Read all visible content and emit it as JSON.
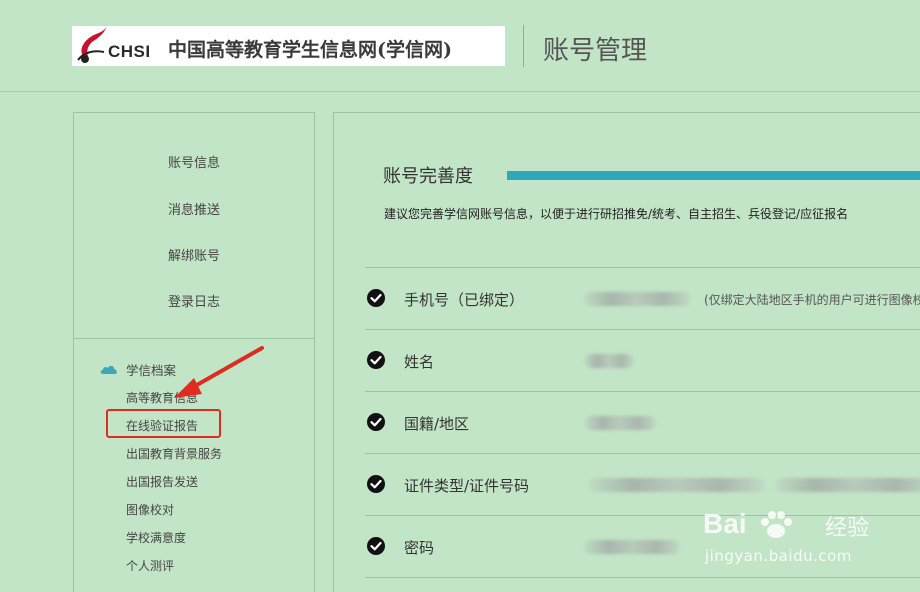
{
  "header": {
    "logo_abbr": "CHSI",
    "site_name": "中国高等教育学生信息网(学信网)",
    "page_title": "账号管理"
  },
  "sidebar": {
    "account_items": [
      {
        "label": "账号信息"
      },
      {
        "label": "消息推送"
      },
      {
        "label": "解绑账号"
      },
      {
        "label": "登录日志"
      }
    ],
    "archive": {
      "title": "学信档案",
      "items": [
        {
          "label": "高等教育信息"
        },
        {
          "label": "在线验证报告"
        },
        {
          "label": "出国教育背景服务"
        },
        {
          "label": "出国报告发送"
        },
        {
          "label": "图像校对"
        },
        {
          "label": "学校满意度"
        },
        {
          "label": "个人测评"
        }
      ]
    },
    "highlighted_item": "在线验证报告"
  },
  "main": {
    "completeness_title": "账号完善度",
    "completeness_level": 1.0,
    "completeness_desc": "建议您完善学信网账号信息，以便于进行研招推免/统考、自主招生、兵役登记/应征报名",
    "fields": [
      {
        "label": "手机号（已绑定）",
        "note": "(仅绑定大陆地区手机的用户可进行图像校"
      },
      {
        "label": "姓名"
      },
      {
        "label": "国籍/地区"
      },
      {
        "label": "证件类型/证件号码"
      },
      {
        "label": "密码"
      }
    ]
  },
  "watermark": {
    "brand": "Bai",
    "brand_suffix": "经验",
    "url": "jingyan.baidu.com"
  },
  "colors": {
    "background": "#c3e5c7",
    "progress": "#2ea9bb",
    "highlight": "#e02b20",
    "accent_cloud": "#3aa8b8"
  }
}
